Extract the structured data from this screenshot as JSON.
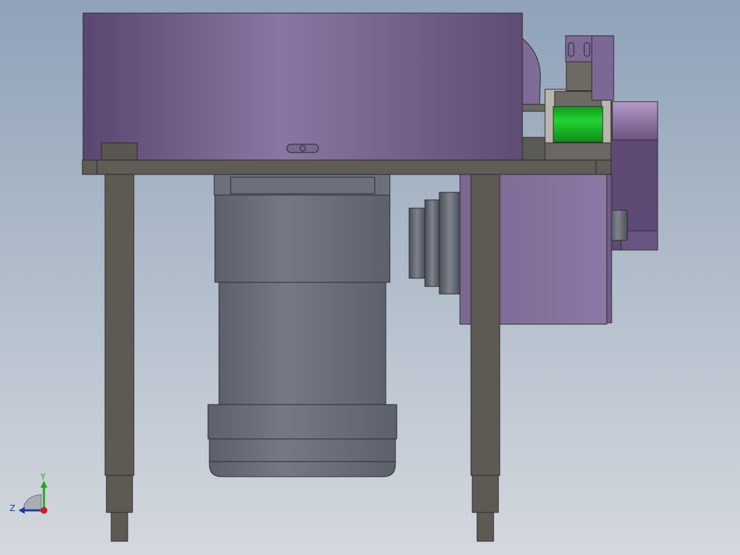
{
  "viewport": {
    "colors": {
      "background_top": "#8fa2b8",
      "background_bottom": "#d4d8de",
      "purple_light": "#8a76a2",
      "purple_dark": "#5b4870",
      "plate_gray": "#5e5a54",
      "motor_gray": "#6f7480",
      "motor_dark": "#4e535d",
      "green": "#18c428",
      "edge": "#2a2a2a"
    }
  },
  "triad": {
    "y_label": "Y",
    "z_label": "Z",
    "y_color": "#1ea51e",
    "z_color": "#1a3a9a",
    "x_color": "#d21e1e"
  }
}
